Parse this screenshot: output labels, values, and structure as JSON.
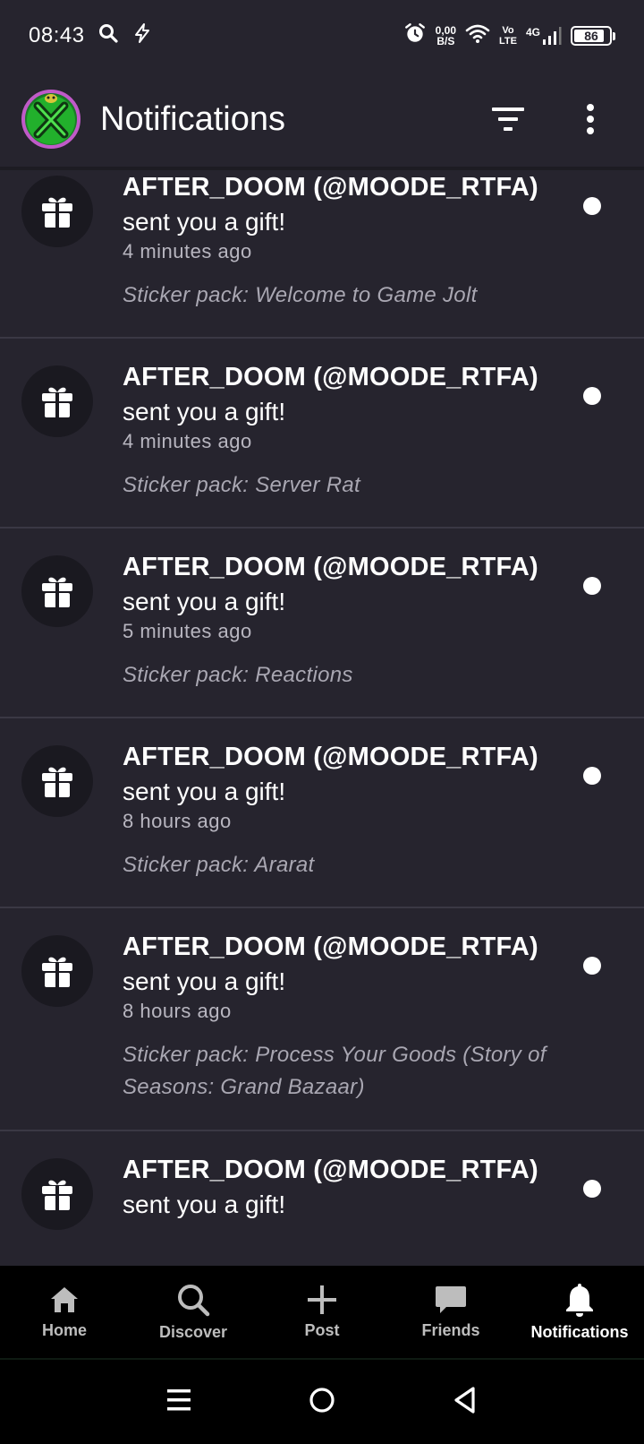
{
  "status_bar": {
    "time": "08:43",
    "net_speed_value": "0,00",
    "net_speed_unit": "B/S",
    "volte_top": "Vo",
    "volte_bottom": "LTE",
    "network": "4G",
    "battery": "86",
    "battery_fraction": 0.86
  },
  "header": {
    "title": "Notifications"
  },
  "notifications": [
    {
      "user": "AFTER_DOOM (@MOODE_RTFA)",
      "action": "sent you a gift!",
      "time": "4 minutes ago",
      "detail": "Sticker pack: Welcome to Game Jolt"
    },
    {
      "user": "AFTER_DOOM (@MOODE_RTFA)",
      "action": "sent you a gift!",
      "time": "4 minutes ago",
      "detail": "Sticker pack: Server Rat"
    },
    {
      "user": "AFTER_DOOM (@MOODE_RTFA)",
      "action": "sent you a gift!",
      "time": "5 minutes ago",
      "detail": "Sticker pack: Reactions"
    },
    {
      "user": "AFTER_DOOM (@MOODE_RTFA)",
      "action": "sent you a gift!",
      "time": "8 hours ago",
      "detail": "Sticker pack: Ararat"
    },
    {
      "user": "AFTER_DOOM (@MOODE_RTFA)",
      "action": "sent you a gift!",
      "time": "8 hours ago",
      "detail": "Sticker pack: Process Your Goods (Story of Seasons: Grand Bazaar)"
    },
    {
      "user": "AFTER_DOOM (@MOODE_RTFA)",
      "action": "sent you a gift!"
    }
  ],
  "bottom_nav": [
    {
      "label": "Home",
      "icon": "home-icon"
    },
    {
      "label": "Discover",
      "icon": "search-icon"
    },
    {
      "label": "Post",
      "icon": "plus-icon"
    },
    {
      "label": "Friends",
      "icon": "chat-icon"
    },
    {
      "label": "Notifications",
      "icon": "bell-icon",
      "active": true
    }
  ],
  "colors": {
    "background": "#26242e",
    "divider": "#3a3844",
    "icon_circle": "#1a1920",
    "nav_background": "#000000"
  }
}
